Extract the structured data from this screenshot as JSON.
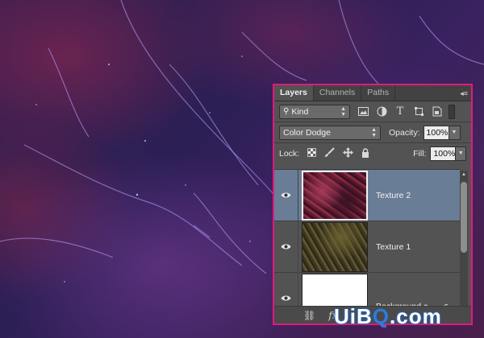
{
  "panel": {
    "tabs": [
      {
        "label": "Layers",
        "active": true
      },
      {
        "label": "Channels",
        "active": false
      },
      {
        "label": "Paths",
        "active": false
      }
    ],
    "filter": {
      "kind_label": "Kind",
      "icons": [
        "image-icon",
        "adjustment-icon",
        "type-icon",
        "shape-icon",
        "smart-object-icon"
      ]
    },
    "blend": {
      "mode": "Color Dodge",
      "opacity_label": "Opacity:",
      "opacity_value": "100%"
    },
    "lock": {
      "label": "Lock:",
      "fill_label": "Fill:",
      "fill_value": "100%"
    },
    "layers": [
      {
        "name": "Texture 2",
        "selected": true
      },
      {
        "name": "Texture 1",
        "selected": false
      },
      {
        "name": "Background c...",
        "selected": false,
        "fx": "fx"
      }
    ],
    "bottom_icons": [
      "link-icon",
      "fx-icon"
    ]
  },
  "watermark": {
    "text_a": "UiB",
    "text_b": "Q",
    "text_c": ".com"
  },
  "colors": {
    "panel_border": "#e21a7a",
    "selected_layer": "#6a7d97",
    "panel_bg": "#535353"
  }
}
